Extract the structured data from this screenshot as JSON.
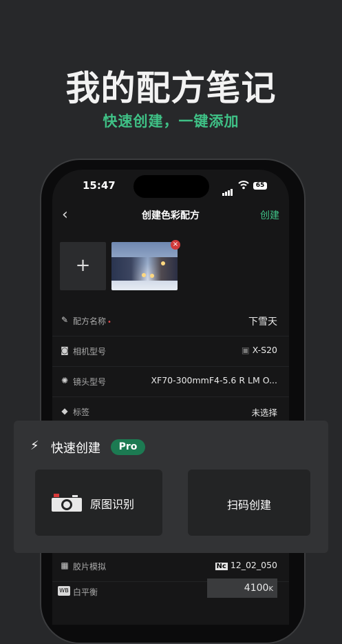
{
  "headline": "我的配方笔记",
  "subline": "快速创建，一键添加",
  "status": {
    "time": "15:47",
    "battery": "65"
  },
  "nav": {
    "back": "‹",
    "title": "创建色彩配方",
    "action": "创建"
  },
  "photos": {
    "add_symbol": "+",
    "remove_symbol": "×"
  },
  "fields": {
    "name": {
      "label": "配方名称",
      "required": "•",
      "value": "下雪天"
    },
    "camera": {
      "label": "相机型号",
      "value": "X-S20"
    },
    "lens": {
      "label": "镜头型号",
      "value": "XF70-300mmF4-5.6 R LM O..."
    },
    "tags": {
      "label": "标签",
      "value": "未选择"
    },
    "film": {
      "label": "胶片模拟",
      "value": "12_02_050",
      "badge": "Nc"
    },
    "wb": {
      "label": "白平衡",
      "value": "4100",
      "unit": "K",
      "badge": "WB"
    }
  },
  "quick_sheet": {
    "title": "快速创建",
    "badge": "Pro",
    "option1": "原图识别",
    "option2": "扫码创建"
  },
  "colors": {
    "accent": "#3fc186",
    "pro_badge": "#1c7a52",
    "required": "#e14848"
  }
}
